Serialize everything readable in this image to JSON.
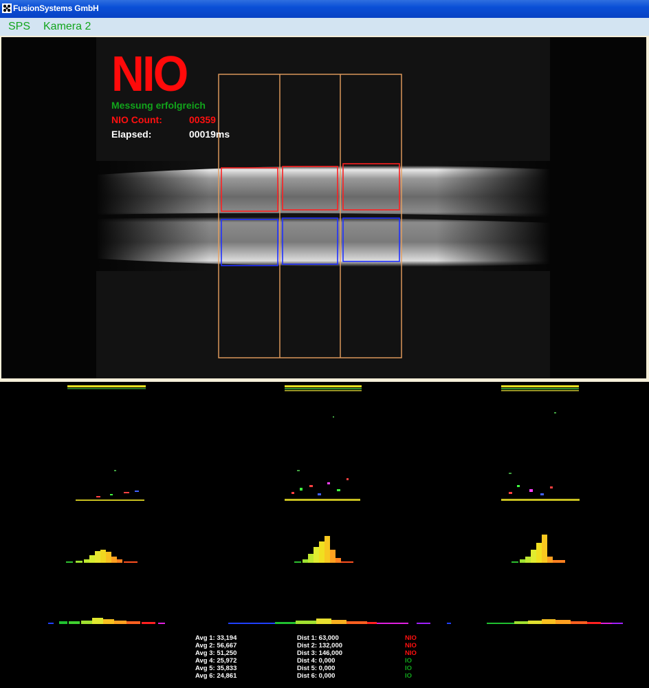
{
  "window": {
    "title": "FusionSystems GmbH"
  },
  "menu": {
    "items": [
      "SPS",
      "Kamera 2"
    ]
  },
  "overlay": {
    "status": "NIO",
    "message": "Messung erfolgreich",
    "nio_count_label": "NIO Count:",
    "nio_count_value": "00359",
    "elapsed_label": "Elapsed:",
    "elapsed_value": "00019ms"
  },
  "colors": {
    "nio": "#ff0a0a",
    "ok": "#11a51b",
    "roi_outer": "#e8a060",
    "roi_top": "#ff2020",
    "roi_bottom": "#2030ff"
  },
  "results": {
    "averages": [
      "Avg 1: 33,194",
      "Avg 2: 56,667",
      "Avg 3: 51,250",
      "Avg 4: 25,972",
      "Avg 5: 35,833",
      "Avg 6: 24,861"
    ],
    "distances": [
      "Dist 1: 63,000",
      "Dist 2: 132,000",
      "Dist 3: 146,000",
      "Dist 4: 0,000",
      "Dist 5: 0,000",
      "Dist 6: 0,000"
    ],
    "verdicts": [
      "NIO",
      "NIO",
      "NIO",
      "IO",
      "IO",
      "IO"
    ]
  }
}
